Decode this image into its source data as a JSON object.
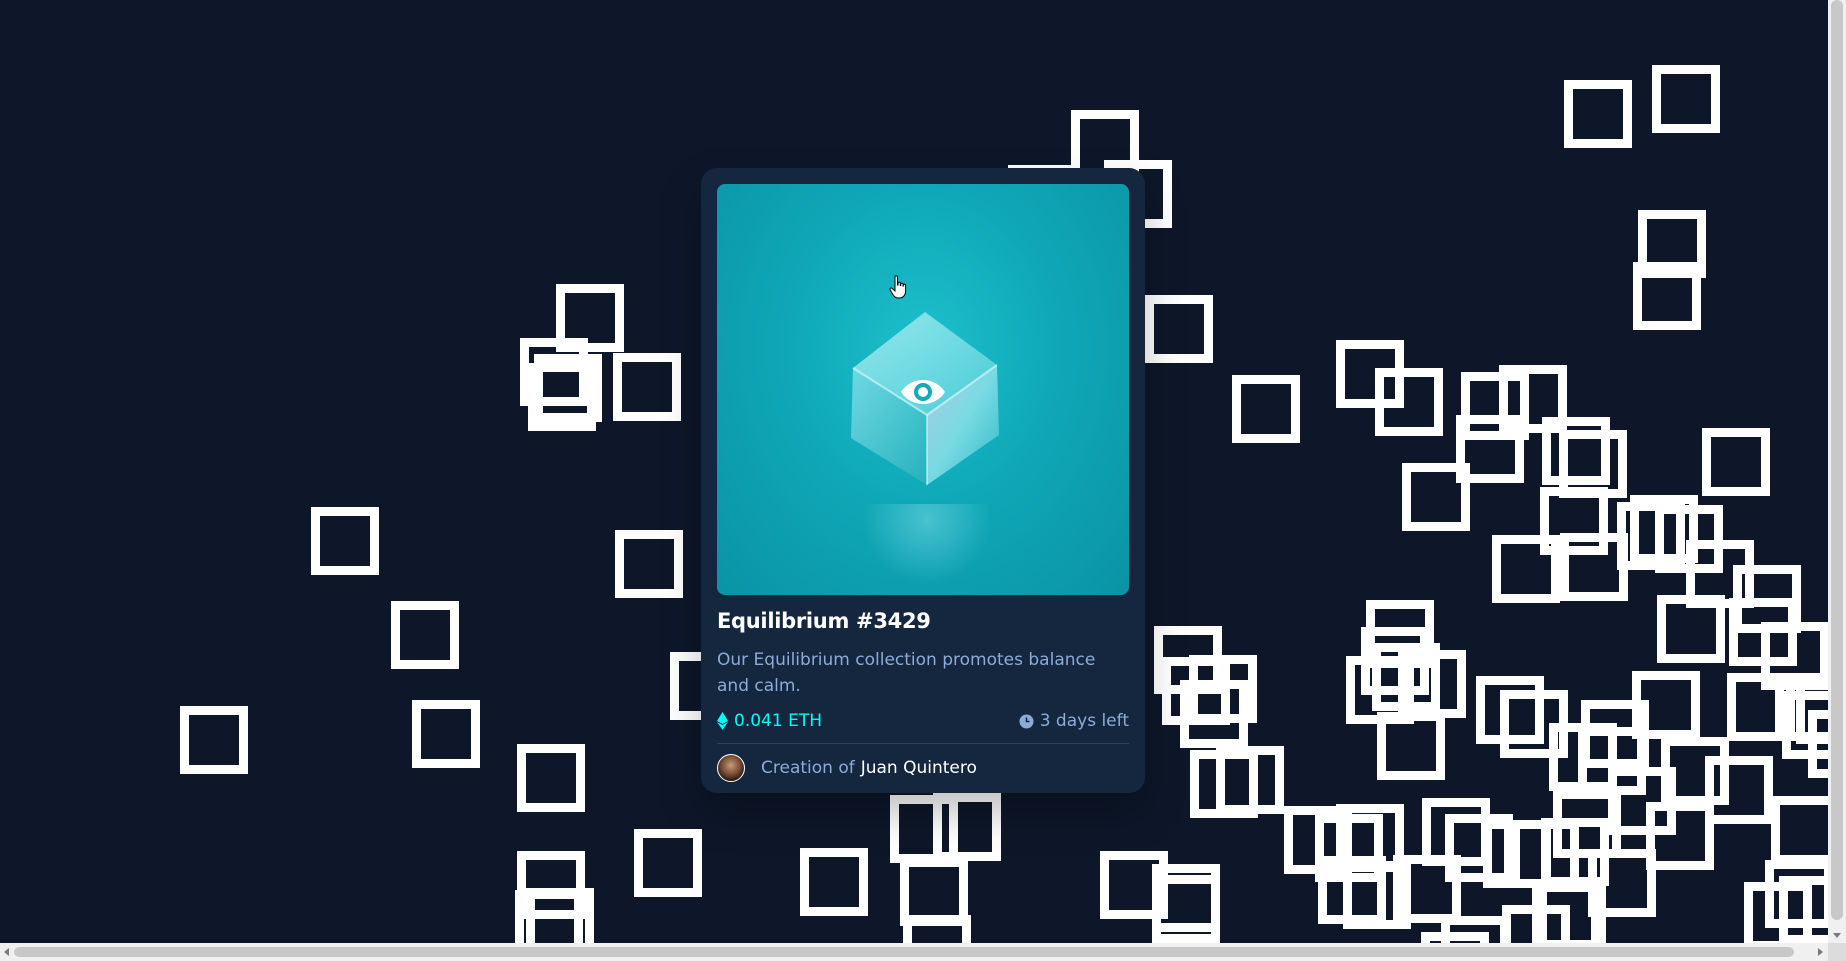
{
  "card": {
    "title": "Equilibrium #3429",
    "description": "Our Equilibrium collection promotes balance and calm.",
    "price": "0.041 ETH",
    "time_left": "3 days left",
    "creator_prefix": "Creation of",
    "creator_name": "Juan Quintero"
  },
  "icons": {
    "view": "eye-icon",
    "currency": "ethereum-icon",
    "time": "clock-icon",
    "pointer": "hand-cursor-icon"
  },
  "colors": {
    "page_background": "#0d1729",
    "card_background": "#15263f",
    "accent_cyan": "#00fff8",
    "soft_blue_text": "#8bacd9",
    "image_teal": "#0fa8b8"
  }
}
